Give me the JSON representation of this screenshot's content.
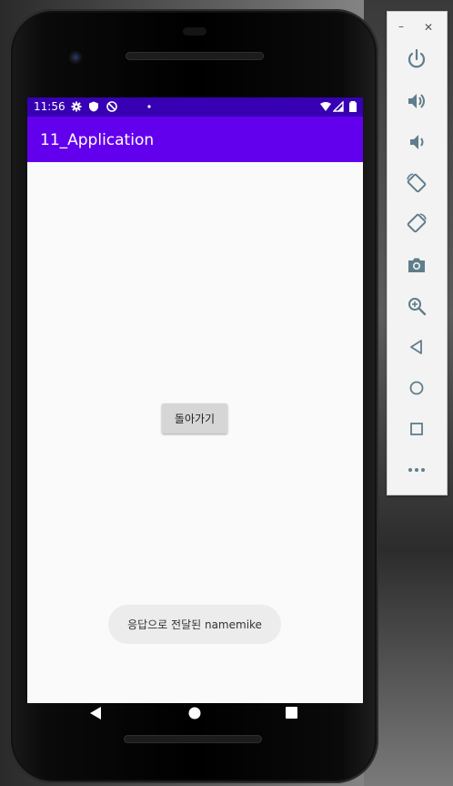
{
  "status_bar": {
    "time": "11:56",
    "icons": [
      "gear-icon",
      "shield-icon",
      "no-sync-icon",
      "dot-icon",
      "wifi-icon",
      "signal-icon",
      "battery-icon"
    ]
  },
  "app_bar": {
    "title": "11_Application"
  },
  "main": {
    "back_button_label": "돌아가기"
  },
  "toast": {
    "message": "응답으로 전달된 namemike"
  },
  "nav_bar": {
    "icons": [
      "back-triangle-icon",
      "home-circle-icon",
      "recents-square-icon"
    ]
  },
  "emulator_panel": {
    "window_controls": [
      "minimize-icon",
      "close-icon"
    ],
    "minimize_glyph": "–",
    "close_glyph": "✕",
    "buttons": [
      "power-icon",
      "volume-up-icon",
      "volume-down-icon",
      "rotate-left-icon",
      "rotate-right-icon",
      "camera-icon",
      "zoom-icon",
      "back-icon",
      "home-icon",
      "overview-icon",
      "more-icon"
    ]
  },
  "colors": {
    "status_bar": "#3700b3",
    "app_bar": "#6200ee",
    "screen_bg": "#fafafa",
    "panel_icon": "#607d8b"
  }
}
